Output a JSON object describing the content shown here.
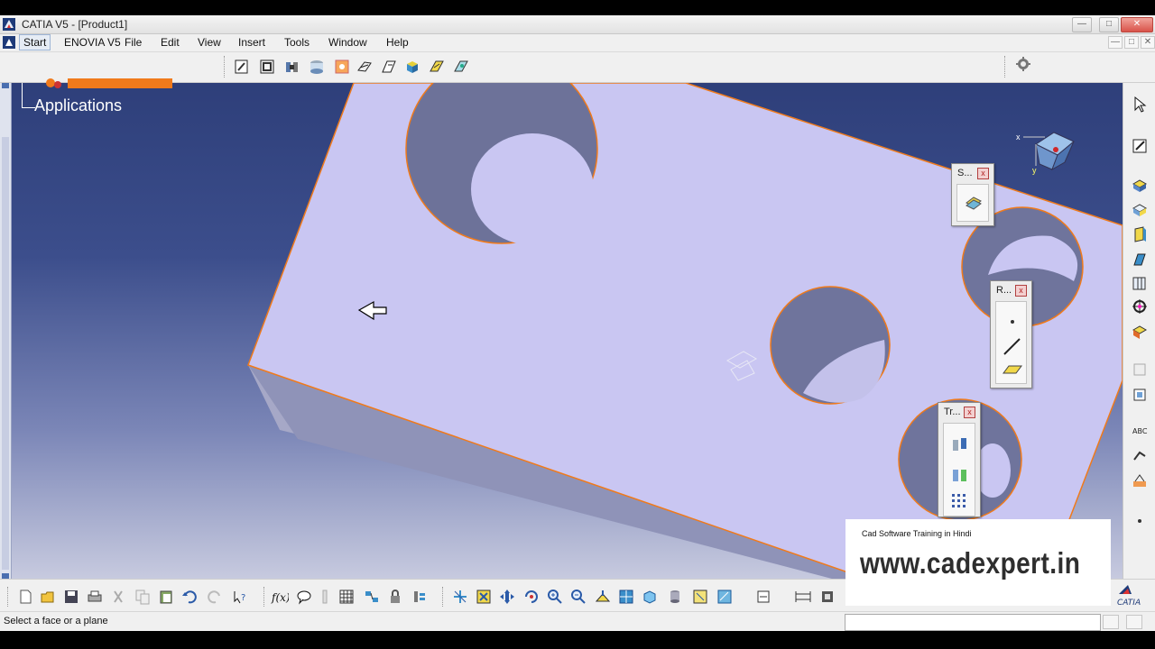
{
  "window": {
    "title": "CATIA V5 - [Product1]",
    "min": "—",
    "max": "□",
    "close": "✕"
  },
  "menu": {
    "items": [
      "Start",
      "ENOVIA V5",
      "File",
      "Edit",
      "View",
      "Insert",
      "Tools",
      "Window",
      "Help"
    ]
  },
  "tree": {
    "label": "Applications"
  },
  "panels": {
    "sketch": {
      "title": "S..."
    },
    "reference": {
      "title": "R..."
    },
    "transform": {
      "title": "Tr..."
    },
    "close": "x"
  },
  "compass": {
    "x": "x",
    "y": "y"
  },
  "watermark": {
    "subtitle": "Cad Software Training in Hindi",
    "site": "www.cadexpert.in"
  },
  "status": {
    "message": "Select a face or a plane",
    "input_value": ""
  },
  "brand": {
    "logo_text": "CATIA"
  },
  "colors": {
    "part_face": "#c9c6f2",
    "part_edge": "#f07a1b",
    "background_top": "#2e3f7a",
    "background_bottom": "#c7cadf"
  },
  "icons": {
    "top_toolbar": [
      "sketcher-icon",
      "sketch-positioned-icon",
      "assembly-design-icon",
      "part-design-icon",
      "generative-shape-icon",
      "wireframe-icon",
      "freestyle-icon",
      "product-icon",
      "kinematics-icon",
      "knowledge-icon"
    ],
    "bottom_toolbar": [
      "new-icon",
      "open-icon",
      "save-icon",
      "print-icon",
      "cut-icon",
      "copy-icon",
      "paste-icon",
      "undo-icon",
      "redo-icon",
      "whats-this-icon",
      "formula-icon",
      "comment-icon",
      "measure-icon",
      "table-icon",
      "catalog-icon",
      "lock-icon",
      "parameters-icon",
      "fly-mode-icon",
      "fit-all-icon",
      "pan-icon",
      "rotate-icon",
      "zoom-in-icon",
      "zoom-out-icon",
      "normal-view-icon",
      "quick-view-icon",
      "view-mode-icon",
      "hide-show-icon",
      "swap-visible-icon",
      "measure-between-icon",
      "measure-item-icon"
    ],
    "right_toolbar": [
      "select-icon",
      "sketch-icon",
      "pad-icon",
      "pocket-icon",
      "shaft-icon",
      "groove-icon",
      "hole-icon",
      "rib-icon",
      "slot-icon",
      "stiffener-icon",
      "plane-icon",
      "text-icon",
      "drafting-icon",
      "annotation-icon",
      "more-icon"
    ]
  }
}
